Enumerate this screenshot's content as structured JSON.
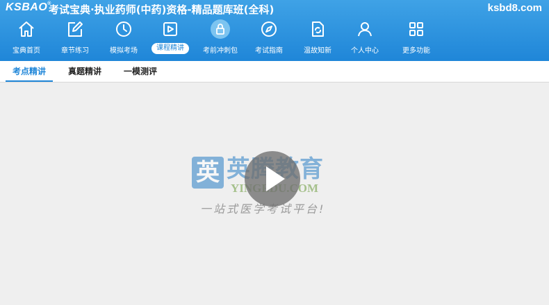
{
  "header": {
    "logo": "KSBAO",
    "logo_mark": "®",
    "title": "考试宝典·执业药师(中药)资格-精品题库班(全科)",
    "site": "ksbd8.com"
  },
  "nav": {
    "items": [
      {
        "label": "宝典首页",
        "icon": "home-icon"
      },
      {
        "label": "章节练习",
        "icon": "edit-icon"
      },
      {
        "label": "模拟考场",
        "icon": "clock-icon"
      },
      {
        "label": "课程精讲",
        "icon": "video-play-icon",
        "active": true
      },
      {
        "label": "考前冲刺包",
        "icon": "lock-icon",
        "locked": true
      },
      {
        "label": "考试指南",
        "icon": "compass-icon"
      },
      {
        "label": "温故知新",
        "icon": "refresh-doc-icon"
      },
      {
        "label": "个人中心",
        "icon": "user-icon"
      },
      {
        "label": "更多功能",
        "icon": "grid-icon"
      }
    ]
  },
  "tabs": [
    {
      "label": "考点精讲",
      "active": true
    },
    {
      "label": "真题精讲"
    },
    {
      "label": "一模测评"
    }
  ],
  "watermark": {
    "badge": "英",
    "brand_cn": "英腾教育",
    "brand_en": "YINGEDU.COM",
    "slogan": "一站式医学考试平台!"
  },
  "player": {
    "play_icon": "play-icon"
  },
  "colors": {
    "header_blue": "#1f86d8",
    "active_tab": "#1f86d8",
    "background": "#efefef"
  }
}
